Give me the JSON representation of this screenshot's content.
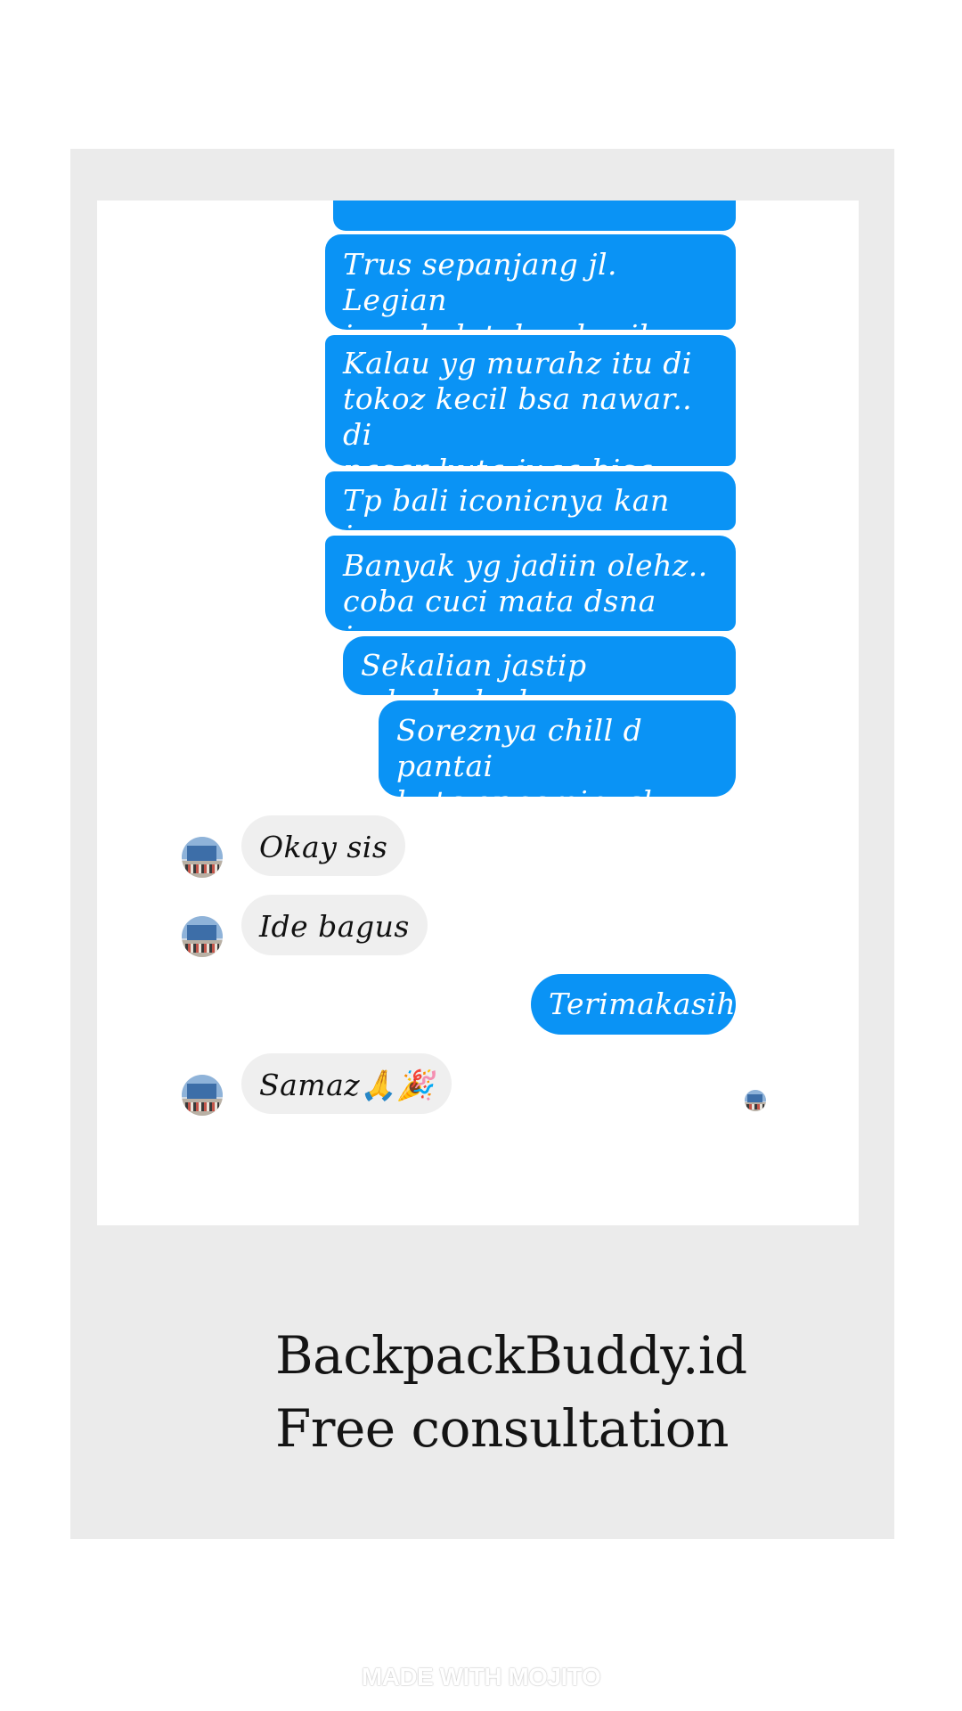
{
  "chat": {
    "messages": [
      {
        "from": "me",
        "text": "Trus sepanjang jl. Legian\njuga byk tokoz kecil"
      },
      {
        "from": "me",
        "text": "Kalau yg murahz itu di\ntokoz kecil bsa nawar.. di\npasar kuta juga bisa"
      },
      {
        "from": "me",
        "text": "Tp bali iconicnya kan joger"
      },
      {
        "from": "me",
        "text": "Banyak yg jadiin olehz..\ncoba cuci mata dsna juga"
      },
      {
        "from": "me",
        "text": "Sekalian jastip wkwkwkwk"
      },
      {
        "from": "me",
        "text": "Soreznya chill d pantai\nkuta or seminyak"
      },
      {
        "from": "them",
        "text": "Okay sis"
      },
      {
        "from": "them",
        "text": "Ide bagus"
      },
      {
        "from": "me",
        "text": "Terimakasih"
      },
      {
        "from": "them",
        "text": "Samaz🙏🎉"
      }
    ],
    "sent_color": "#0a93f5",
    "received_color": "#efefef"
  },
  "caption": {
    "line1": "BackpackBuddy.id",
    "line2": "Free consultation"
  },
  "watermark": "MADE WITH MOJITO"
}
